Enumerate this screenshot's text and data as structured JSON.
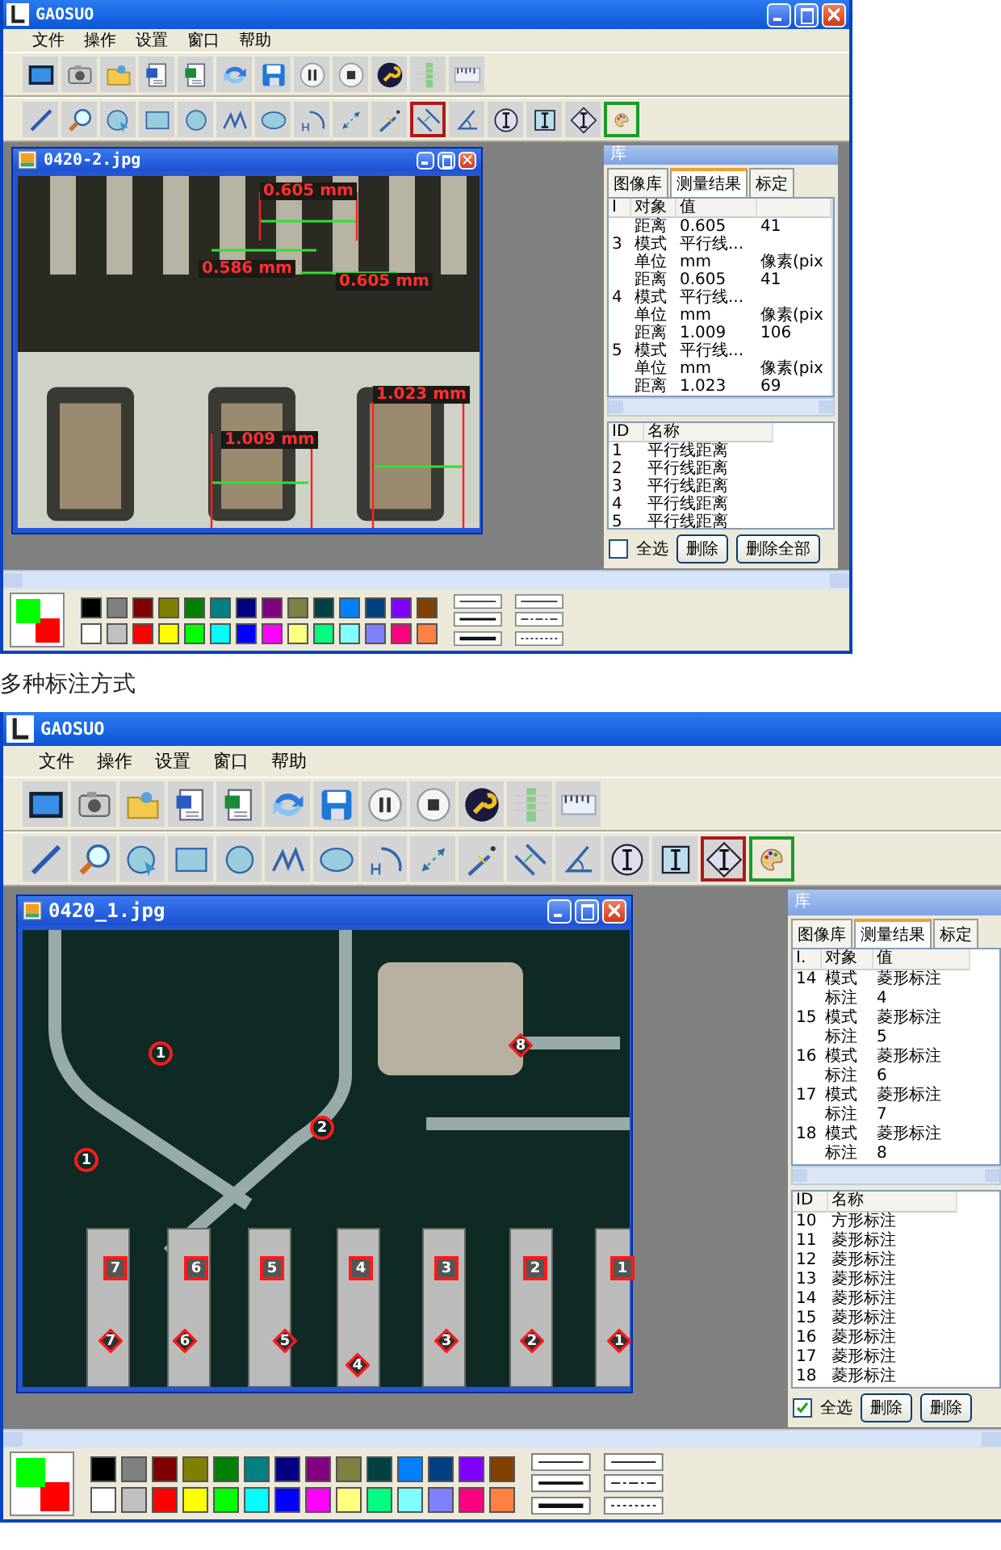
{
  "windows": [
    {
      "title": "GAOSUO",
      "controls_visible": true,
      "menu": [
        "文件",
        "操作",
        "设置",
        "窗口",
        "帮助"
      ],
      "tools": [
        {
          "selected": false
        },
        {
          "selected": false
        },
        {
          "selected": false
        },
        {
          "selected": false
        },
        {
          "selected": false
        },
        {
          "selected": false
        },
        {
          "selected": false
        },
        {
          "selected": false
        },
        {
          "selected": false
        },
        {
          "selected": false
        },
        {
          "selected": true
        },
        {
          "selected": false
        },
        {
          "selected": false
        },
        {
          "selected": false
        },
        {
          "selected": false
        }
      ],
      "image_window": {
        "title": "0420-2.jpg",
        "annotations": [
          {
            "kind": "measure",
            "label": "0.605 mm"
          },
          {
            "kind": "measure",
            "label": "0.586 mm"
          },
          {
            "kind": "measure",
            "label": "0.605 mm"
          },
          {
            "kind": "measure",
            "label": "1.023 mm"
          },
          {
            "kind": "measure",
            "label": "1.009 mm"
          }
        ]
      },
      "library": {
        "title": "库",
        "tabs": [
          {
            "label": "图像库",
            "selected": false
          },
          {
            "label": "测量结果",
            "selected": true
          },
          {
            "label": "标定",
            "selected": false
          }
        ],
        "columns": [
          "I",
          "对象",
          "值",
          ""
        ],
        "rows": [
          [
            "",
            "距离",
            "0.605",
            "41"
          ],
          [
            "3",
            "模式",
            "平行线...",
            ""
          ],
          [
            "",
            "单位",
            "mm",
            "像素(pix"
          ],
          [
            "",
            "距离",
            "0.605",
            "41"
          ],
          [
            "4",
            "模式",
            "平行线...",
            ""
          ],
          [
            "",
            "单位",
            "mm",
            "像素(pix"
          ],
          [
            "",
            "距离",
            "1.009",
            "106"
          ],
          [
            "5",
            "模式",
            "平行线...",
            ""
          ],
          [
            "",
            "单位",
            "mm",
            "像素(pix"
          ],
          [
            "",
            "距离",
            "1.023",
            "69"
          ]
        ],
        "list_columns": [
          "ID",
          "名称"
        ],
        "list": [
          [
            "1",
            "平行线距离"
          ],
          [
            "2",
            "平行线距离"
          ],
          [
            "3",
            "平行线距离"
          ],
          [
            "4",
            "平行线距离"
          ],
          [
            "5",
            "平行线距离"
          ]
        ],
        "select_all": {
          "label": "全选",
          "checked": false
        },
        "buttons": [
          "删除",
          "删除全部"
        ]
      },
      "current_colors": [
        {
          "color": "#00ff00"
        },
        {
          "color": "#ff0000"
        }
      ],
      "swatches": [
        {
          "color": "#000000"
        },
        {
          "color": "#808080"
        },
        {
          "color": "#800000"
        },
        {
          "color": "#808000"
        },
        {
          "color": "#008000"
        },
        {
          "color": "#008080"
        },
        {
          "color": "#000080"
        },
        {
          "color": "#800080"
        },
        {
          "color": "#808040"
        },
        {
          "color": "#004040"
        },
        {
          "color": "#0080ff"
        },
        {
          "color": "#004080"
        },
        {
          "color": "#8000ff"
        },
        {
          "color": "#804000"
        },
        {
          "color": "#ffffff"
        },
        {
          "color": "#c0c0c0"
        },
        {
          "color": "#ff0000"
        },
        {
          "color": "#ffff00"
        },
        {
          "color": "#00ff00"
        },
        {
          "color": "#00ffff"
        },
        {
          "color": "#0000ff"
        },
        {
          "color": "#ff00ff"
        },
        {
          "color": "#ffff80"
        },
        {
          "color": "#00ff80"
        },
        {
          "color": "#80ffff"
        },
        {
          "color": "#8080ff"
        },
        {
          "color": "#ff0080"
        },
        {
          "color": "#ff8040"
        }
      ]
    },
    {
      "title": "GAOSUO",
      "controls_visible": false,
      "menu": [
        "文件",
        "操作",
        "设置",
        "窗口",
        "帮助"
      ],
      "tools": [
        {
          "selected": false
        },
        {
          "selected": false
        },
        {
          "selected": false
        },
        {
          "selected": false
        },
        {
          "selected": false
        },
        {
          "selected": false
        },
        {
          "selected": false
        },
        {
          "selected": false
        },
        {
          "selected": false
        },
        {
          "selected": false
        },
        {
          "selected": false
        },
        {
          "selected": false
        },
        {
          "selected": false
        },
        {
          "selected": false
        },
        {
          "selected": true
        }
      ],
      "image_window": {
        "title": "0420_1.jpg",
        "annotations": [
          {
            "kind": "circle",
            "label": "1"
          },
          {
            "kind": "circle",
            "label": "2"
          },
          {
            "kind": "circle",
            "label": "1"
          },
          {
            "kind": "diamond",
            "label": "8"
          },
          {
            "kind": "square",
            "label": "7"
          },
          {
            "kind": "square",
            "label": "6"
          },
          {
            "kind": "square",
            "label": "5"
          },
          {
            "kind": "square",
            "label": "4"
          },
          {
            "kind": "square",
            "label": "3"
          },
          {
            "kind": "square",
            "label": "2"
          },
          {
            "kind": "square",
            "label": "1"
          },
          {
            "kind": "diamond",
            "label": "7"
          },
          {
            "kind": "diamond",
            "label": "6"
          },
          {
            "kind": "diamond",
            "label": "5"
          },
          {
            "kind": "diamond",
            "label": "4"
          },
          {
            "kind": "diamond",
            "label": "3"
          },
          {
            "kind": "diamond",
            "label": "2"
          },
          {
            "kind": "diamond",
            "label": "1"
          }
        ]
      },
      "library": {
        "title": "库",
        "tabs": [
          {
            "label": "图像库",
            "selected": false
          },
          {
            "label": "测量结果",
            "selected": true
          },
          {
            "label": "标定",
            "selected": false
          }
        ],
        "columns": [
          "I.",
          "对象",
          "值"
        ],
        "rows": [
          [
            "14",
            "模式",
            "菱形标注"
          ],
          [
            "",
            "标注",
            "4"
          ],
          [
            "15",
            "模式",
            "菱形标注"
          ],
          [
            "",
            "标注",
            "5"
          ],
          [
            "16",
            "模式",
            "菱形标注"
          ],
          [
            "",
            "标注",
            "6"
          ],
          [
            "17",
            "模式",
            "菱形标注"
          ],
          [
            "",
            "标注",
            "7"
          ],
          [
            "18",
            "模式",
            "菱形标注"
          ],
          [
            "",
            "标注",
            "8"
          ]
        ],
        "list_columns": [
          "ID",
          "名称"
        ],
        "list": [
          [
            "10",
            "方形标注"
          ],
          [
            "11",
            "菱形标注"
          ],
          [
            "12",
            "菱形标注"
          ],
          [
            "13",
            "菱形标注"
          ],
          [
            "14",
            "菱形标注"
          ],
          [
            "15",
            "菱形标注"
          ],
          [
            "16",
            "菱形标注"
          ],
          [
            "17",
            "菱形标注"
          ],
          [
            "18",
            "菱形标注"
          ]
        ],
        "select_all": {
          "label": "全选",
          "checked": true
        },
        "buttons": [
          "删除",
          "删除"
        ]
      },
      "current_colors": [
        {
          "color": "#00ff00"
        },
        {
          "color": "#ff0000"
        }
      ],
      "swatches": [
        {
          "color": "#000000"
        },
        {
          "color": "#808080"
        },
        {
          "color": "#800000"
        },
        {
          "color": "#808000"
        },
        {
          "color": "#008000"
        },
        {
          "color": "#008080"
        },
        {
          "color": "#000080"
        },
        {
          "color": "#800080"
        },
        {
          "color": "#808040"
        },
        {
          "color": "#004040"
        },
        {
          "color": "#0080ff"
        },
        {
          "color": "#004080"
        },
        {
          "color": "#8000ff"
        },
        {
          "color": "#804000"
        },
        {
          "color": "#ffffff"
        },
        {
          "color": "#c0c0c0"
        },
        {
          "color": "#ff0000"
        },
        {
          "color": "#ffff00"
        },
        {
          "color": "#00ff00"
        },
        {
          "color": "#00ffff"
        },
        {
          "color": "#0000ff"
        },
        {
          "color": "#ff00ff"
        },
        {
          "color": "#ffff80"
        },
        {
          "color": "#00ff80"
        },
        {
          "color": "#80ffff"
        },
        {
          "color": "#8080ff"
        },
        {
          "color": "#ff0080"
        },
        {
          "color": "#ff8040"
        }
      ]
    }
  ],
  "caption": "多种标注方式"
}
